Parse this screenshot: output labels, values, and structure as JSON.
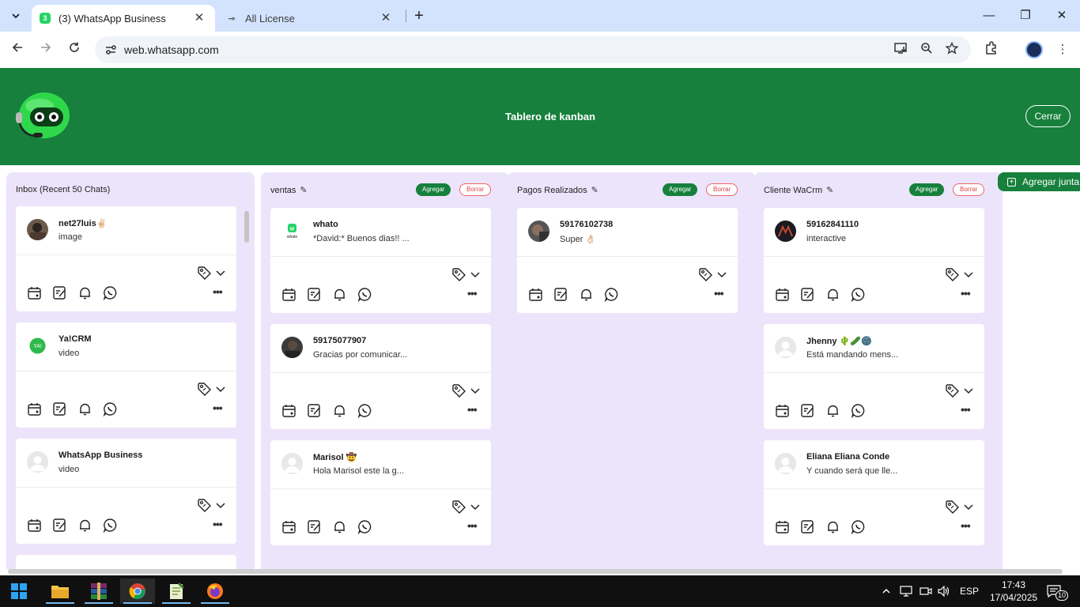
{
  "browser": {
    "tabs": [
      {
        "title": "(3) WhatsApp Business",
        "favicon_text": "3",
        "active": true
      },
      {
        "title": "All License",
        "favicon_text": "⊸",
        "active": false
      }
    ],
    "url": "web.whatsapp.com"
  },
  "header": {
    "title": "Tablero de kanban",
    "close_label": "Cerrar"
  },
  "board": {
    "add_board_label": "Agregar junta",
    "columns": [
      {
        "title": "Inbox (Recent 50 Chats)",
        "editable": false,
        "cards": [
          {
            "name": "net27luis✌🏻",
            "message": "image"
          },
          {
            "name": "Ya!CRM",
            "message": "video"
          },
          {
            "name": "WhatsApp Business",
            "message": "video"
          }
        ]
      },
      {
        "title": "ventas",
        "editable": true,
        "add_label": "Agregar",
        "delete_label": "Borrar",
        "cards": [
          {
            "name": "whato",
            "message": "*David:* Buenos dias!! ..."
          },
          {
            "name": "59175077907",
            "message": "Gracias por comunicar..."
          },
          {
            "name": "Marisol 🤠",
            "message": "Hola Marisol este la g..."
          }
        ]
      },
      {
        "title": "Pagos Realizados",
        "editable": true,
        "add_label": "Agregar",
        "delete_label": "Borrar",
        "cards": [
          {
            "name": "59176102738",
            "message": "Super 👌🏻"
          }
        ]
      },
      {
        "title": "Cliente WaCrm",
        "editable": true,
        "add_label": "Agregar",
        "delete_label": "Borrar",
        "cards": [
          {
            "name": "59162841110",
            "message": "interactive"
          },
          {
            "name": "Jhenny 🌵🥒🌚",
            "message": "Está mandando mens..."
          },
          {
            "name": "Eliana Eliana Conde",
            "message": "Y cuando será que lle..."
          }
        ]
      }
    ]
  },
  "taskbar": {
    "language": "ESP",
    "time": "17:43",
    "date": "17/04/2025",
    "notifications": "10"
  },
  "colors": {
    "header_green": "#16803c",
    "column_bg": "#ece4fb",
    "agregar_green": "#16803c",
    "borrar_red": "#dd4444"
  }
}
